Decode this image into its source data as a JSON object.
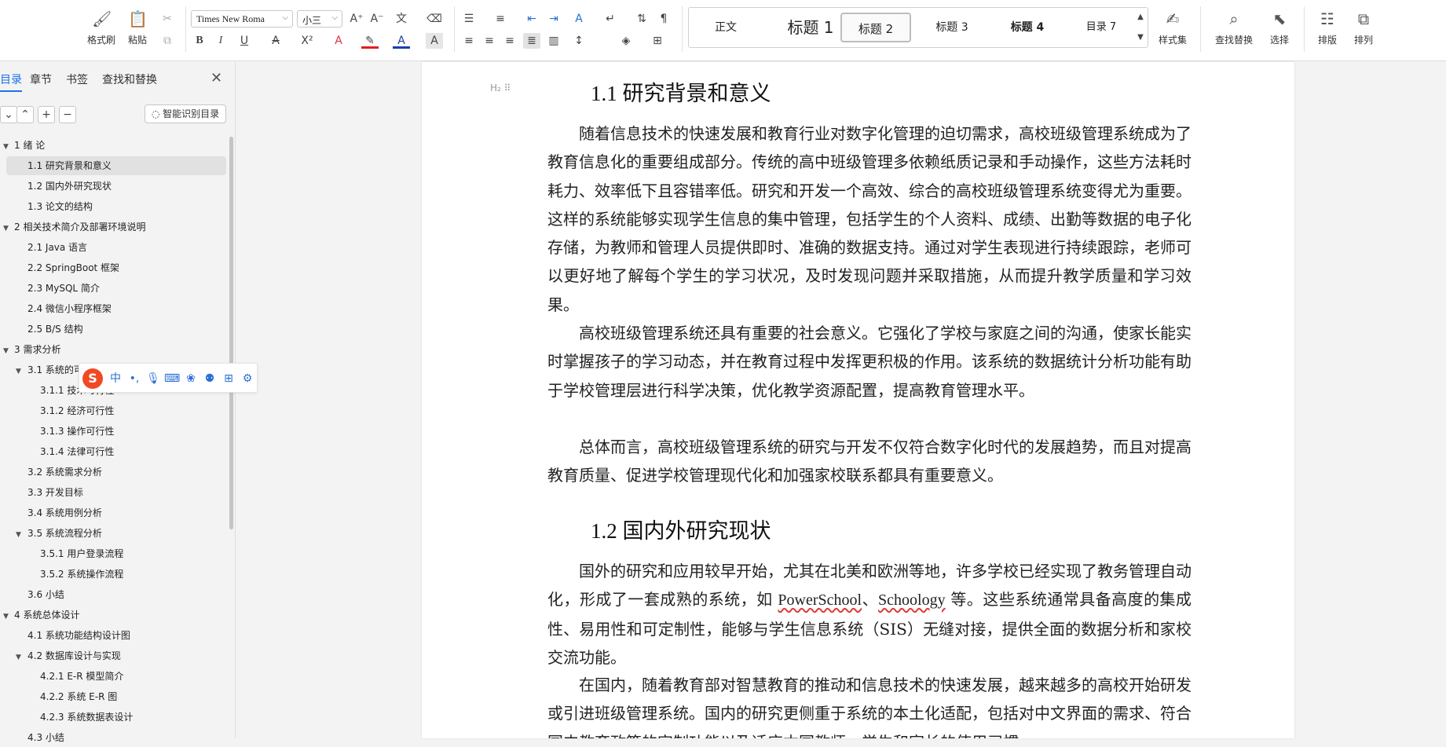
{
  "ribbon": {
    "clipboard": {
      "format_painter": "格式刷",
      "paste": "粘贴"
    },
    "font": {
      "family": "Times New Roma",
      "size": "小三"
    },
    "styles": [
      {
        "label": "正文"
      },
      {
        "label": "标题  1"
      },
      {
        "label": "标题  2"
      },
      {
        "label": "标题  3"
      },
      {
        "label": "标题 4"
      },
      {
        "label": "目录  7"
      }
    ],
    "style_set": "样式集",
    "find_replace": "查找替换",
    "select": "选择",
    "layout": "排版",
    "arrange": "排列"
  },
  "nav": {
    "tabs": [
      "目录",
      "章节",
      "书签",
      "查找和替换"
    ],
    "smart_toc": "智能识别目录",
    "items": [
      "1  绪   论",
      "1.1 研究背景和意义",
      "1.2 国内外研究现状",
      "1.3 论文的结构",
      "2  相关技术简介及部署环境说明",
      "2.1 Java 语言",
      "2.2 SpringBoot 框架",
      "2.3 MySQL 简介",
      "2.4  微信小程序框架",
      "2.5 B/S 结构",
      "3  需求分析",
      "3.1 系统的可行性分析",
      "3.1.1   技术可行性",
      "3.1.2   经济可行性",
      "3.1.3   操作可行性",
      "3.1.4   法律可行性",
      "3.2 系统需求分析",
      "3.3 开发目标",
      "3.4  系统用例分析",
      "3.5 系统流程分析",
      "3.5.1  用户登录流程",
      "3.5.2  系统操作流程",
      "3.6 小结",
      "4  系统总体设计",
      "4.1 系统功能结构设计图",
      "4.2  数据库设计与实现",
      "4.2.1   E-R 模型简介",
      "4.2.2   系统 E-R 图",
      "4.2.3  系统数据表设计",
      "4.3 小结"
    ]
  },
  "ime": {
    "mode": "中"
  },
  "document": {
    "h2_marker": "H₂",
    "heading1": "1.1 研究背景和意义",
    "p1": "随着信息技术的快速发展和教育行业对数字化管理的迫切需求，高校班级管理系统成为了教育信息化的重要组成部分。传统的高中班级管理多依赖纸质记录和手动操作，这些方法耗时耗力、效率低下且容错率低。研究和开发一个高效、综合的高校班级管理系统变得尤为重要。这样的系统能够实现学生信息的集中管理，包括学生的个人资料、成绩、出勤等数据的电子化存储，为教师和管理人员提供即时、准确的数据支持。通过对学生表现进行持续跟踪，老师可以更好地了解每个学生的学习状况，及时发现问题并采取措施，从而提升教学质量和学习效果。",
    "p2": "高校班级管理系统还具有重要的社会意义。它强化了学校与家庭之间的沟通，使家长能实时掌握孩子的学习动态，并在教育过程中发挥更积极的作用。该系统的数据统计分析功能有助于学校管理层进行科学决策，优化教学资源配置，提高教育管理水平。",
    "p3": "总体而言，高校班级管理系统的研究与开发不仅符合数字化时代的发展趋势，而且对提高教育质量、促进学校管理现代化和加强家校联系都具有重要意义。",
    "heading2": "1.2 国内外研究现状",
    "p4_a": "国外的研究和应用较早开始，尤其在北美和欧洲等地，许多学校已经实现了教务管理自动化，形成了一套成熟的系统，如 ",
    "p4_w1": "PowerSchool",
    "p4_b": "、",
    "p4_w2": "Schoology",
    "p4_c": " 等。这些系统通常具备高度的集成性、易用性和可定制性，能够与学生信息系统（SIS）无缝对接，提供全面的数据分析和家校交流功能。",
    "p5": "在国内，随着教育部对智慧教育的推动和信息技术的快速发展，越来越多的高校开始研发或引进班级管理系统。国内的研究更侧重于系统的本土化适配，包括对中文界面的需求、符合国内教育政策的定制功能以及适应本国教师、学生和家长的使用习惯。"
  }
}
